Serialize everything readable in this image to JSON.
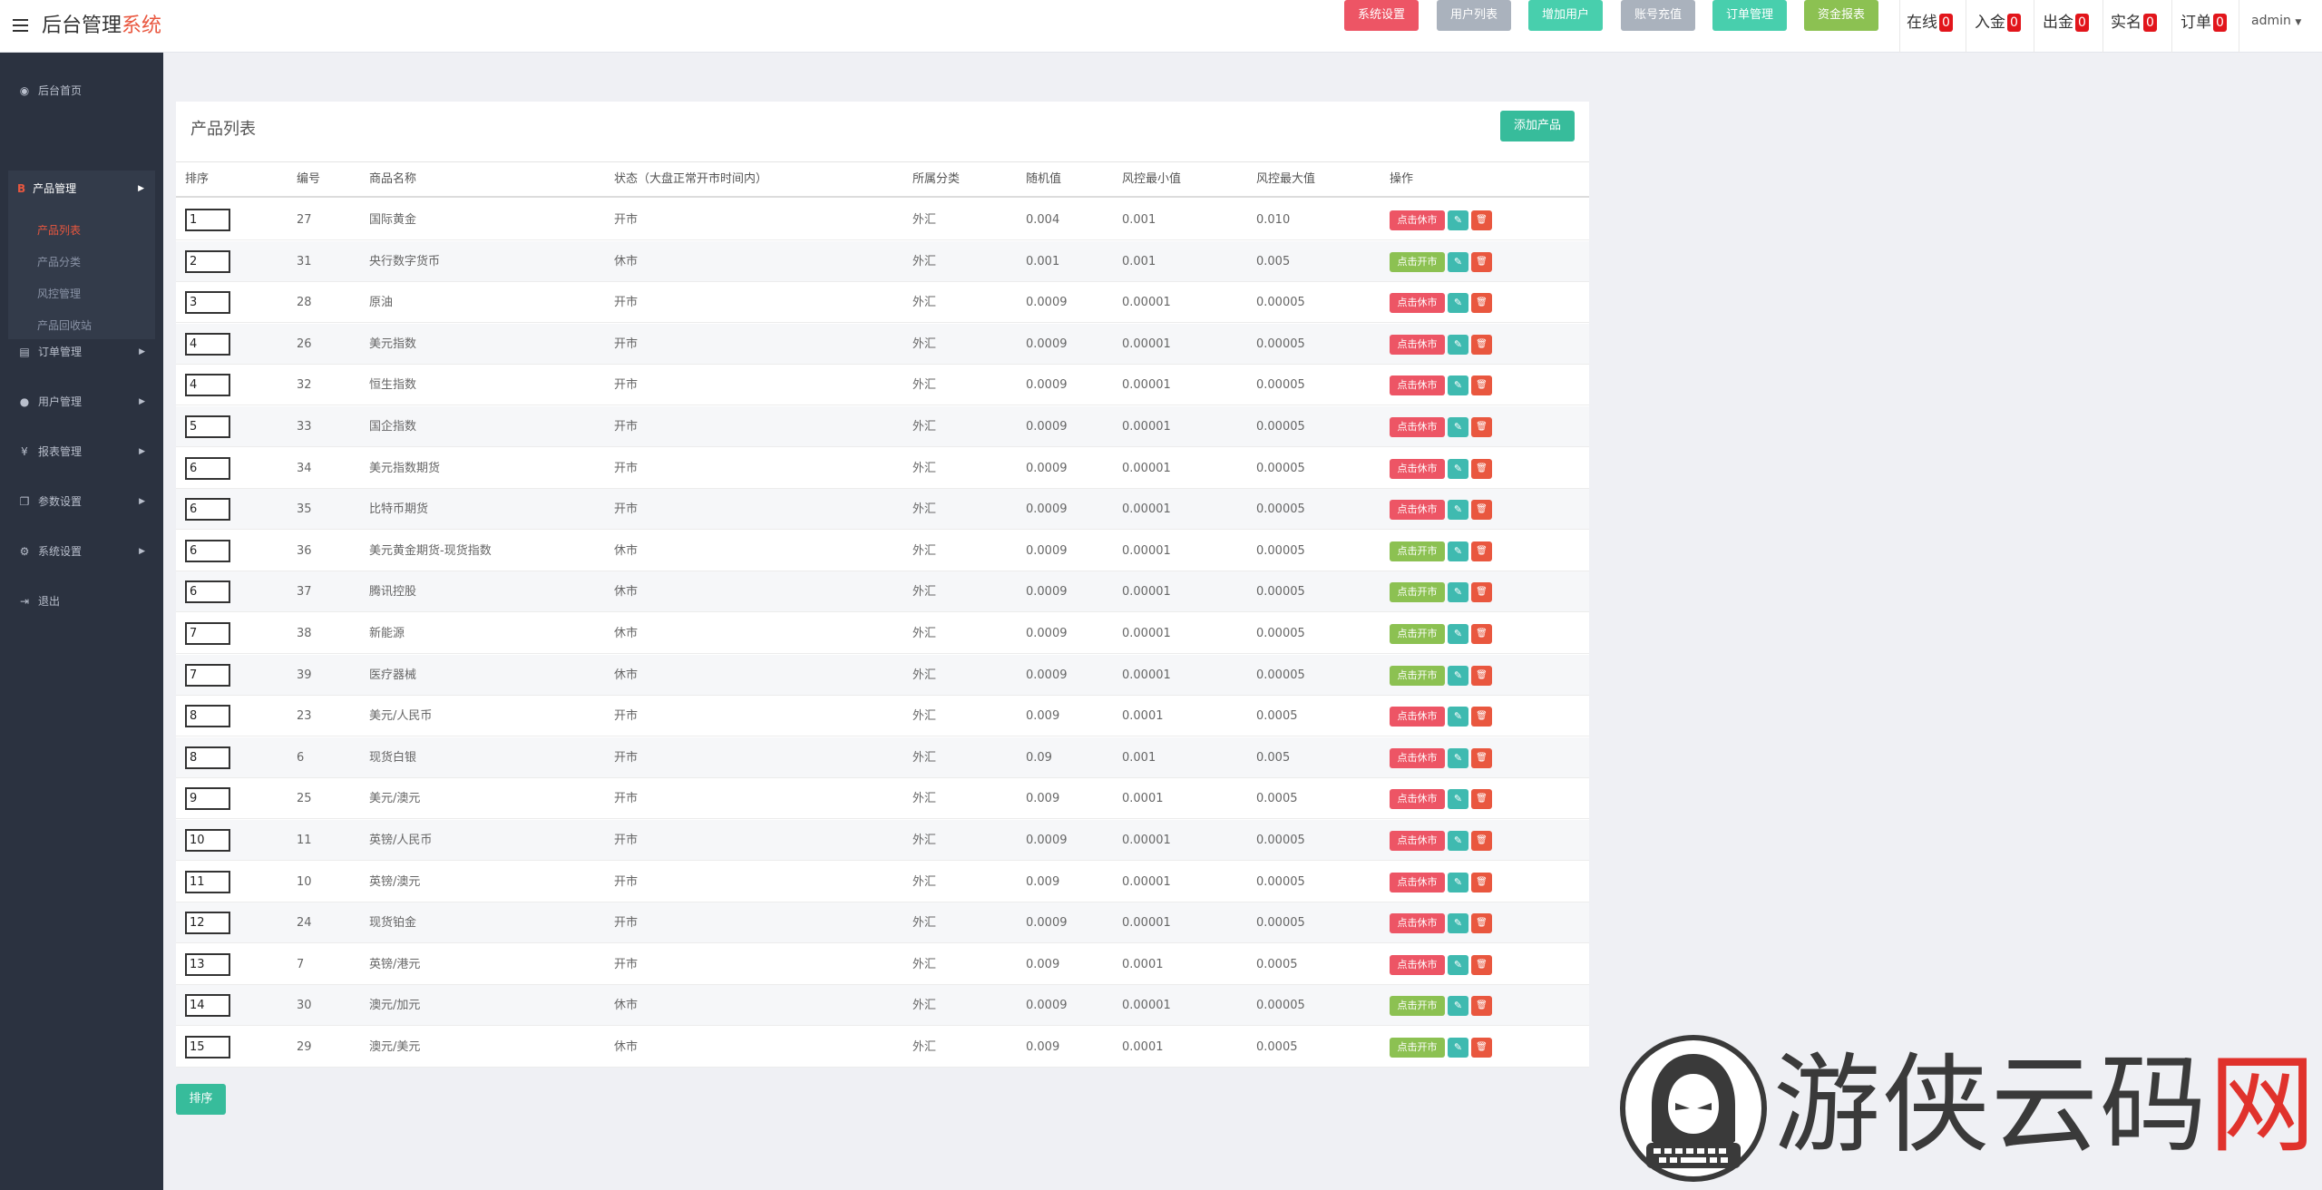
{
  "header": {
    "brand_main": "后台管理",
    "brand_accent": "系统",
    "buttons": [
      {
        "label": "系统设置",
        "color": "#ed5565"
      },
      {
        "label": "用户列表",
        "color": "#aab2bd"
      },
      {
        "label": "增加用户",
        "color": "#48cfad"
      },
      {
        "label": "账号充值",
        "color": "#aab2bd"
      },
      {
        "label": "订单管理",
        "color": "#48cfad"
      },
      {
        "label": "资金报表",
        "color": "#8cc152"
      }
    ],
    "stats": [
      {
        "label": "在线",
        "count": "0"
      },
      {
        "label": "入金",
        "count": "0"
      },
      {
        "label": "出金",
        "count": "0"
      },
      {
        "label": "实名",
        "count": "0"
      },
      {
        "label": "订单",
        "count": "0"
      }
    ],
    "admin": "admin"
  },
  "sidebar": {
    "home": "后台首页",
    "product_group": {
      "label": "产品管理",
      "items": [
        "产品列表",
        "产品分类",
        "风控管理",
        "产品回收站"
      ]
    },
    "items": [
      "订单管理",
      "用户管理",
      "报表管理",
      "参数设置",
      "系统设置",
      "退出"
    ]
  },
  "panel": {
    "title": "产品列表",
    "add_button": "添加产品",
    "columns": [
      "排序",
      "编号",
      "商品名称",
      "状态（大盘正常开市时间内）",
      "所属分类",
      "随机值",
      "风控最小值",
      "风控最大值",
      "操作"
    ],
    "rows": [
      {
        "sort": "1",
        "id": "27",
        "name": "国际黄金",
        "status": "开市",
        "category": "外汇",
        "rand": "0.004",
        "min": "0.001",
        "max": "0.010",
        "action": "点击休市"
      },
      {
        "sort": "2",
        "id": "31",
        "name": "央行数字货币",
        "status": "休市",
        "category": "外汇",
        "rand": "0.001",
        "min": "0.001",
        "max": "0.005",
        "action": "点击开市"
      },
      {
        "sort": "3",
        "id": "28",
        "name": "原油",
        "status": "开市",
        "category": "外汇",
        "rand": "0.0009",
        "min": "0.00001",
        "max": "0.00005",
        "action": "点击休市"
      },
      {
        "sort": "4",
        "id": "26",
        "name": "美元指数",
        "status": "开市",
        "category": "外汇",
        "rand": "0.0009",
        "min": "0.00001",
        "max": "0.00005",
        "action": "点击休市"
      },
      {
        "sort": "4",
        "id": "32",
        "name": "恒生指数",
        "status": "开市",
        "category": "外汇",
        "rand": "0.0009",
        "min": "0.00001",
        "max": "0.00005",
        "action": "点击休市"
      },
      {
        "sort": "5",
        "id": "33",
        "name": "国企指数",
        "status": "开市",
        "category": "外汇",
        "rand": "0.0009",
        "min": "0.00001",
        "max": "0.00005",
        "action": "点击休市"
      },
      {
        "sort": "6",
        "id": "34",
        "name": "美元指数期货",
        "status": "开市",
        "category": "外汇",
        "rand": "0.0009",
        "min": "0.00001",
        "max": "0.00005",
        "action": "点击休市"
      },
      {
        "sort": "6",
        "id": "35",
        "name": "比特币期货",
        "status": "开市",
        "category": "外汇",
        "rand": "0.0009",
        "min": "0.00001",
        "max": "0.00005",
        "action": "点击休市"
      },
      {
        "sort": "6",
        "id": "36",
        "name": "美元黄金期货-现货指数",
        "status": "休市",
        "category": "外汇",
        "rand": "0.0009",
        "min": "0.00001",
        "max": "0.00005",
        "action": "点击开市"
      },
      {
        "sort": "6",
        "id": "37",
        "name": "腾讯控股",
        "status": "休市",
        "category": "外汇",
        "rand": "0.0009",
        "min": "0.00001",
        "max": "0.00005",
        "action": "点击开市"
      },
      {
        "sort": "7",
        "id": "38",
        "name": "新能源",
        "status": "休市",
        "category": "外汇",
        "rand": "0.0009",
        "min": "0.00001",
        "max": "0.00005",
        "action": "点击开市"
      },
      {
        "sort": "7",
        "id": "39",
        "name": "医疗器械",
        "status": "休市",
        "category": "外汇",
        "rand": "0.0009",
        "min": "0.00001",
        "max": "0.00005",
        "action": "点击开市"
      },
      {
        "sort": "8",
        "id": "23",
        "name": "美元/人民币",
        "status": "开市",
        "category": "外汇",
        "rand": "0.009",
        "min": "0.0001",
        "max": "0.0005",
        "action": "点击休市"
      },
      {
        "sort": "8",
        "id": "6",
        "name": "现货白银",
        "status": "开市",
        "category": "外汇",
        "rand": "0.09",
        "min": "0.001",
        "max": "0.005",
        "action": "点击休市"
      },
      {
        "sort": "9",
        "id": "25",
        "name": "美元/澳元",
        "status": "开市",
        "category": "外汇",
        "rand": "0.009",
        "min": "0.0001",
        "max": "0.0005",
        "action": "点击休市"
      },
      {
        "sort": "10",
        "id": "11",
        "name": "英镑/人民币",
        "status": "开市",
        "category": "外汇",
        "rand": "0.0009",
        "min": "0.00001",
        "max": "0.00005",
        "action": "点击休市"
      },
      {
        "sort": "11",
        "id": "10",
        "name": "英镑/澳元",
        "status": "开市",
        "category": "外汇",
        "rand": "0.009",
        "min": "0.00001",
        "max": "0.00005",
        "action": "点击休市"
      },
      {
        "sort": "12",
        "id": "24",
        "name": "现货铂金",
        "status": "开市",
        "category": "外汇",
        "rand": "0.0009",
        "min": "0.00001",
        "max": "0.00005",
        "action": "点击休市"
      },
      {
        "sort": "13",
        "id": "7",
        "name": "英镑/港元",
        "status": "开市",
        "category": "外汇",
        "rand": "0.009",
        "min": "0.0001",
        "max": "0.0005",
        "action": "点击休市"
      },
      {
        "sort": "14",
        "id": "30",
        "name": "澳元/加元",
        "status": "休市",
        "category": "外汇",
        "rand": "0.0009",
        "min": "0.00001",
        "max": "0.00005",
        "action": "点击开市"
      },
      {
        "sort": "15",
        "id": "29",
        "name": "澳元/美元",
        "status": "休市",
        "category": "外汇",
        "rand": "0.009",
        "min": "0.0001",
        "max": "0.0005",
        "action": "点击开市"
      }
    ]
  },
  "footer": {
    "sort_button": "排序"
  },
  "colors": {
    "close_market": "#ed5565",
    "open_market": "#8cc152",
    "edit": "#3fbab0",
    "delete": "#e9573f"
  },
  "watermark": {
    "text_dark": "游侠云码",
    "text_red": "网"
  }
}
